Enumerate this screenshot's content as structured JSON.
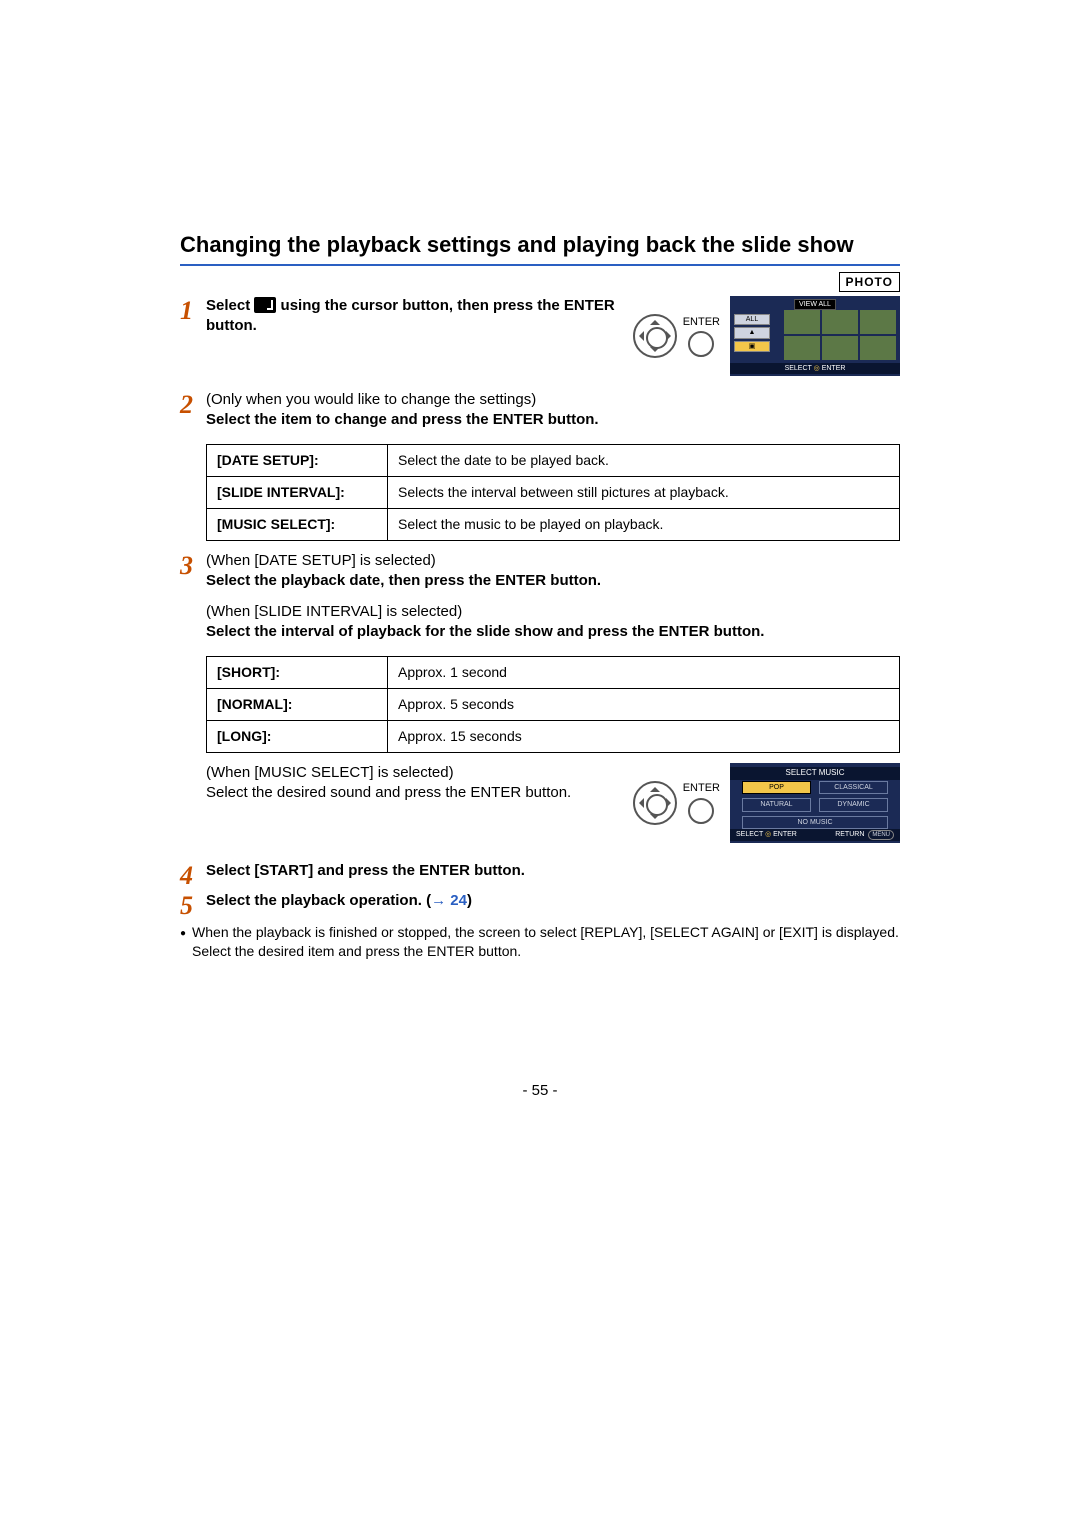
{
  "title": "Changing the playback settings and playing back the slide show",
  "photo_badge": "PHOTO",
  "step1": {
    "pre": "Select ",
    "mid": " using the cursor button, then press the ENTER button."
  },
  "enter_label": "ENTER",
  "lcd1": {
    "view_all": "VIEW ALL",
    "all": "ALL",
    "select_enter": "SELECT",
    "enter_word": "ENTER"
  },
  "step2": {
    "pre": "(Only when you would like to change the settings)",
    "main": "Select the item to change and press the ENTER button."
  },
  "table1": {
    "rows": [
      {
        "k": "[DATE SETUP]:",
        "v": "Select the date to be played back."
      },
      {
        "k": "[SLIDE INTERVAL]:",
        "v": "Selects the interval between still pictures at playback."
      },
      {
        "k": "[MUSIC SELECT]:",
        "v": "Select the music to be played on playback."
      }
    ]
  },
  "step3": {
    "a_pre": "(When [DATE SETUP] is selected)",
    "a_main": "Select the playback date, then press the ENTER button.",
    "b_pre": "(When [SLIDE INTERVAL] is selected)",
    "b_main": "Select the interval of playback for the slide show and press the ENTER button."
  },
  "table2": {
    "rows": [
      {
        "k": "[SHORT]:",
        "v": "Approx. 1 second"
      },
      {
        "k": "[NORMAL]:",
        "v": "Approx. 5 seconds"
      },
      {
        "k": "[LONG]:",
        "v": "Approx. 15 seconds"
      }
    ]
  },
  "step3c": {
    "pre": "(When [MUSIC SELECT] is selected)",
    "main": "Select the desired sound and press the ENTER button."
  },
  "lcd2": {
    "title": "SELECT MUSIC",
    "opts": [
      "POP",
      "CLASSICAL",
      "NATURAL",
      "DYNAMIC",
      "NO MUSIC"
    ],
    "select": "SELECT",
    "enter": "ENTER",
    "return": "RETURN",
    "menu": "MENU"
  },
  "step4": "Select [START] and press the ENTER button.",
  "step5": {
    "text": "Select the playback operation. (",
    "arrow": "→",
    "ref": " 24",
    "close": ")"
  },
  "note": "When the playback is finished or stopped, the screen to select [REPLAY], [SELECT AGAIN] or [EXIT] is displayed. Select the desired item and press the ENTER button.",
  "page_num": "- 55 -"
}
